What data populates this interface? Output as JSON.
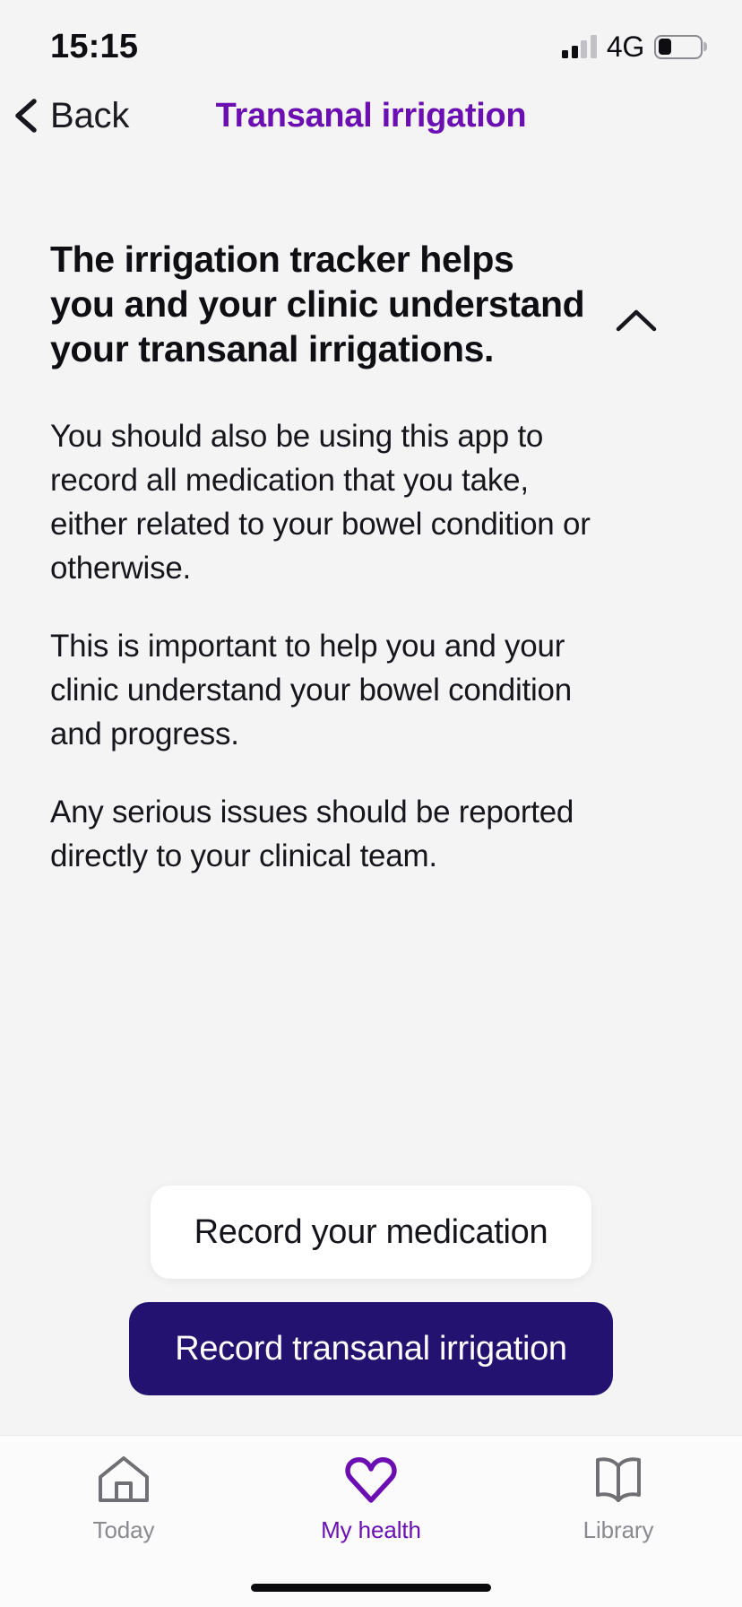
{
  "status_bar": {
    "time": "15:15",
    "network_label": "4G",
    "signal_icon": "signal-bars-icon",
    "signal_bars_filled": 2,
    "signal_bars_total": 4,
    "battery_icon": "battery-icon",
    "battery_percent": 32
  },
  "nav": {
    "back_label": "Back",
    "back_icon": "chevron-left-icon",
    "title": "Transanal irrigation"
  },
  "accordion": {
    "title": "The irrigation tracker helps you and your clinic understand your transanal irrigations.",
    "toggle_icon": "chevron-up-icon",
    "expanded": true,
    "paragraphs": [
      "You should also be using this app to record all medication that you take, either related to your bowel condition or otherwise.",
      "This is important to help you and your clinic understand your bowel condition and progress.",
      "Any serious issues should be reported directly to your clinical team."
    ]
  },
  "actions": {
    "secondary_label": "Record your medication",
    "primary_label": "Record transanal irrigation"
  },
  "tabbar": {
    "items": [
      {
        "label": "Today",
        "icon": "home-icon",
        "active": false
      },
      {
        "label": "My health",
        "icon": "heart-icon",
        "active": true
      },
      {
        "label": "Library",
        "icon": "book-icon",
        "active": false
      }
    ]
  },
  "colors": {
    "background": "#f4f4f4",
    "title_purple": "#6b0fb3",
    "primary_button": "#241270",
    "tab_inactive": "#8a8a8f",
    "text": "#16161c"
  }
}
